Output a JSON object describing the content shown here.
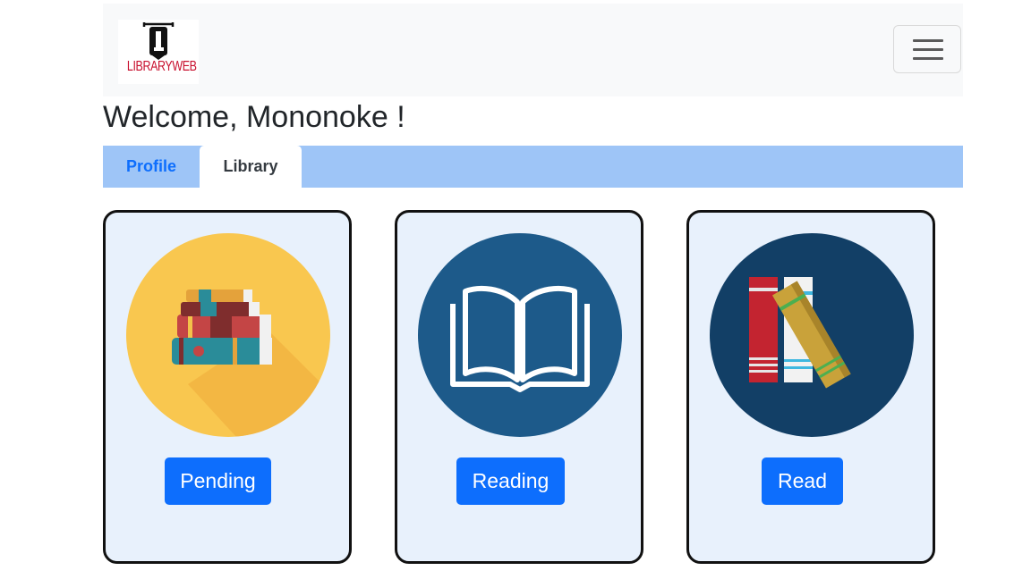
{
  "logo": {
    "text": "LIBRARYWEB",
    "icon": "library-logo-icon"
  },
  "navbar": {
    "toggle_icon": "hamburger-menu-icon"
  },
  "welcome": "Welcome, Mononoke !",
  "tabs": [
    {
      "label": "Profile",
      "active": false
    },
    {
      "label": "Library",
      "active": true
    }
  ],
  "cards": [
    {
      "label": "Pending",
      "icon": "book-stack-icon",
      "circle_color": "#f9c74f"
    },
    {
      "label": "Reading",
      "icon": "open-book-icon",
      "circle_color": "#1d5a8a"
    },
    {
      "label": "Read",
      "icon": "bookshelf-icon",
      "circle_color": "#123f66"
    }
  ],
  "colors": {
    "primary": "#0d6efd",
    "tabbar": "#9ec5f7",
    "card_bg": "#e8f1fc"
  }
}
